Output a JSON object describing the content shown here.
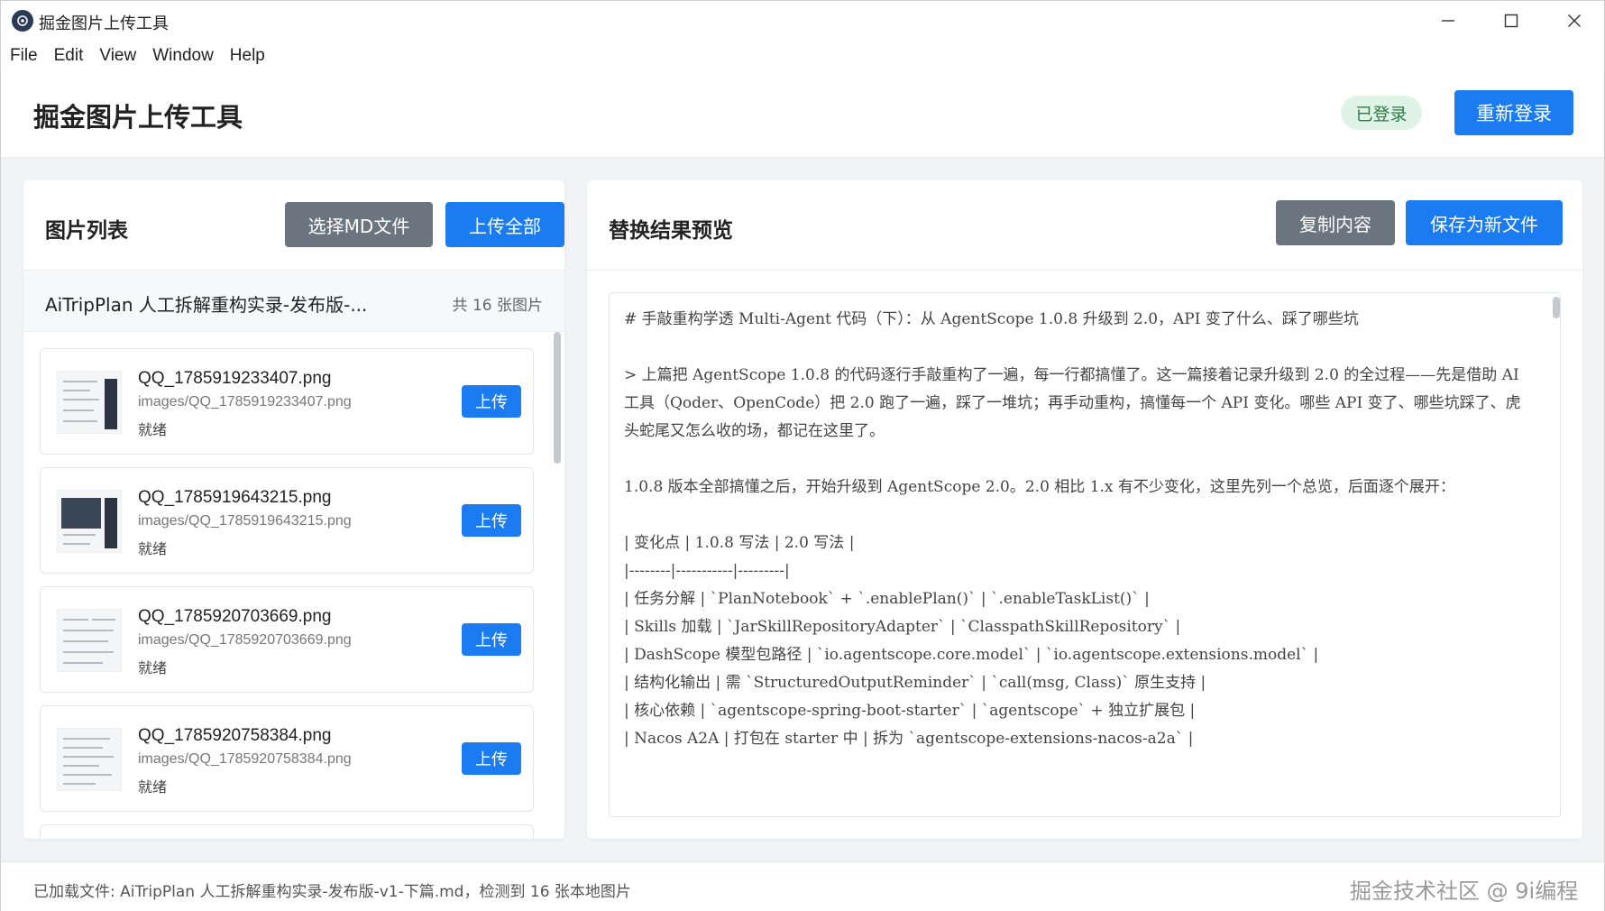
{
  "window": {
    "title": "掘金图片上传工具",
    "controls": [
      "minimize-icon",
      "maximize-icon",
      "close-icon"
    ]
  },
  "menu": [
    "File",
    "Edit",
    "View",
    "Window",
    "Help"
  ],
  "header": {
    "title": "掘金图片上传工具",
    "status_badge": "已登录",
    "relogin_label": "重新登录"
  },
  "left_panel": {
    "title": "图片列表",
    "select_md_label": "选择MD文件",
    "upload_all_label": "上传全部",
    "file_name": "AiTripPlan 人工拆解重构实录-发布版-...",
    "file_count": "共 16 张图片",
    "images": [
      {
        "name": "QQ_1785919233407.png",
        "path": "images/QQ_1785919233407.png",
        "status": "就绪",
        "upload_label": "上传"
      },
      {
        "name": "QQ_1785919643215.png",
        "path": "images/QQ_1785919643215.png",
        "status": "就绪",
        "upload_label": "上传"
      },
      {
        "name": "QQ_1785920703669.png",
        "path": "images/QQ_1785920703669.png",
        "status": "就绪",
        "upload_label": "上传"
      },
      {
        "name": "QQ_1785920758384.png",
        "path": "images/QQ_1785920758384.png",
        "status": "就绪",
        "upload_label": "上传"
      }
    ]
  },
  "right_panel": {
    "title": "替换结果预览",
    "copy_label": "复制内容",
    "save_label": "保存为新文件",
    "preview_lines": [
      "# 手敲重构学透 Multi-Agent 代码（下）：从 AgentScope 1.0.8 升级到 2.0，API 变了什么、踩了哪些坑",
      "",
      "> 上篇把 AgentScope 1.0.8 的代码逐行手敲重构了一遍，每一行都搞懂了。这一篇接着记录升级到 2.0 的全过程——先是借助 AI 工具（Qoder、OpenCode）把 2.0 跑了一遍，踩了一堆坑；再手动重构，搞懂每一个 API 变化。哪些 API 变了、哪些坑踩了、虎头蛇尾又怎么收的场，都记在这里了。",
      "",
      "1.0.8 版本全部搞懂之后，开始升级到 AgentScope 2.0。2.0 相比 1.x 有不少变化，这里先列一个总览，后面逐个展开：",
      "",
      "| 变化点 | 1.0.8 写法 | 2.0 写法 |",
      "|--------|-----------|---------|",
      "| 任务分解 | `PlanNotebook` + `.enablePlan()` | `.enableTaskList()` |",
      "| Skills 加载 | `JarSkillRepositoryAdapter` | `ClasspathSkillRepository` |",
      "| DashScope 模型包路径 | `io.agentscope.core.model` | `io.agentscope.extensions.model` |",
      "| 结构化输出 | 需 `StructuredOutputReminder` | `call(msg, Class)` 原生支持 |",
      "| 核心依赖 | `agentscope-spring-boot-starter` | `agentscope` + 独立扩展包 |",
      "| Nacos A2A | 打包在 starter 中 | 拆为 `agentscope-extensions-nacos-a2a` |"
    ]
  },
  "statusbar": {
    "text": "已加载文件: AiTripPlan 人工拆解重构实录-发布版-v1-下篇.md，检测到 16 张本地图片",
    "watermark": "掘金技术社区 @ 9i编程"
  },
  "colors": {
    "primary": "#1a7cf0",
    "secondary": "#6b7580",
    "badge_bg": "#dff3e6",
    "badge_text": "#2d7a47",
    "background": "#f2f3f5"
  }
}
